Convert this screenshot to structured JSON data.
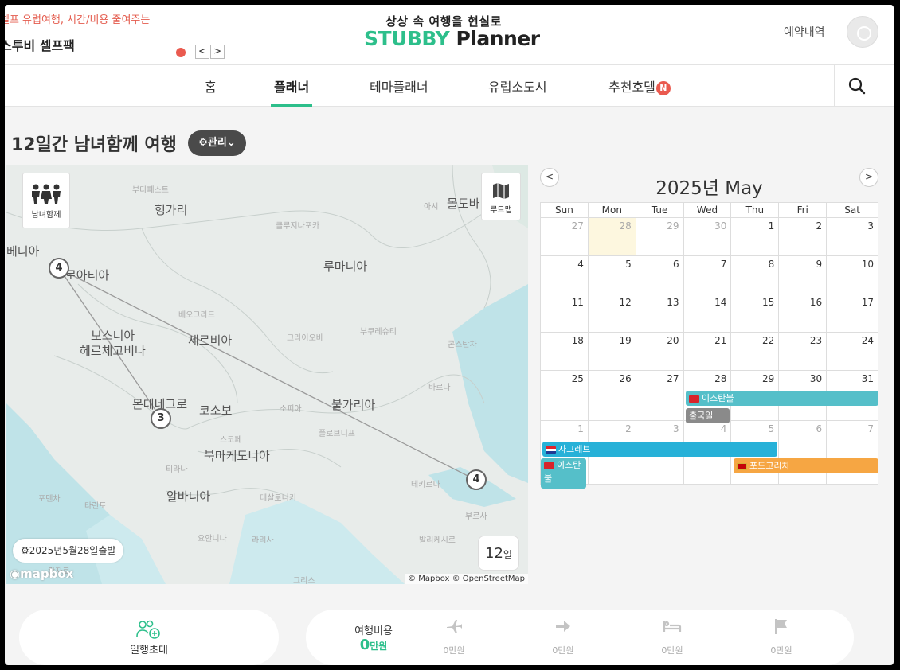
{
  "header": {
    "promo_line": "셀프 유럽여행, 시간/비용 줄여주는",
    "promo_title": "스투비 셀프팩",
    "prev": "<",
    "next": ">",
    "brand_sub": "상상 속 여행을 현실로",
    "brand_stubby": "STUBBY",
    "brand_planner": "Planner",
    "reservations": "예약내역"
  },
  "nav": {
    "items": [
      "홈",
      "플래너",
      "테마플래너",
      "유럽소도시",
      "추천호텔"
    ],
    "active_index": 1,
    "badge": "N"
  },
  "trip": {
    "title": "12일간 남녀함께 여행",
    "manage": "관리"
  },
  "map": {
    "companion_label": "남녀함께",
    "routemap_label": "루트맵",
    "departure": "2025년5월28일출발",
    "days_num": "12",
    "days_unit": "일",
    "logo": "mapbox",
    "attribution": "© Mapbox © OpenStreetMap",
    "markers": [
      "4",
      "3",
      "4"
    ],
    "labels_big": [
      "헝가리",
      "몰도바",
      "베니아",
      "로아티아",
      "루마니아",
      "보스니아",
      "헤르체고비나",
      "세르비아",
      "몬테네그로",
      "코소보",
      "불가리아",
      "북마케도니아",
      "알바니아"
    ],
    "labels_small": [
      "부다페스트",
      "클루지나포카",
      "아시",
      "베오그라드",
      "크라이오바",
      "부쿠레슈티",
      "콘스탄차",
      "바르나",
      "소피아",
      "스코페",
      "플로브디프",
      "티라나",
      "테살로니키",
      "테키르다",
      "포텐차",
      "타란토",
      "요안니나",
      "라리사",
      "부르사",
      "발리케시르",
      "칸자로",
      "그리스"
    ]
  },
  "calendar": {
    "prev": "<",
    "next": ">",
    "title": "2025년 May",
    "dow": [
      "Sun",
      "Mon",
      "Tue",
      "Wed",
      "Thu",
      "Fri",
      "Sat"
    ],
    "weeks": [
      [
        "27",
        "28",
        "29",
        "30",
        "1",
        "2",
        "3"
      ],
      [
        "4",
        "5",
        "6",
        "7",
        "8",
        "9",
        "10"
      ],
      [
        "11",
        "12",
        "13",
        "14",
        "15",
        "16",
        "17"
      ],
      [
        "18",
        "19",
        "20",
        "21",
        "22",
        "23",
        "24"
      ],
      [
        "25",
        "26",
        "27",
        "28",
        "29",
        "30",
        "31"
      ],
      [
        "1",
        "2",
        "3",
        "4",
        "5",
        "6",
        "7"
      ]
    ],
    "events": {
      "istanbul_1": "이스탄불",
      "departure_day": "출국일",
      "zagreb": "자그레브",
      "istanbul_2_a": "이스탄",
      "istanbul_2_b": "불",
      "podgorica": "포드고리차"
    }
  },
  "bottom": {
    "invite_label": "일행초대",
    "cost_label": "여행비용",
    "cost_value": "0",
    "cost_unit": "만원",
    "items": [
      "0만원",
      "0만원",
      "0만원",
      "0만원"
    ]
  },
  "colors": {
    "accent": "#2dbf8b",
    "alert": "#ea5a4f",
    "event_teal": "#55bfc9",
    "event_blue": "#27b1d8",
    "event_orange": "#f6a643",
    "event_gray": "#8a8a8a"
  }
}
